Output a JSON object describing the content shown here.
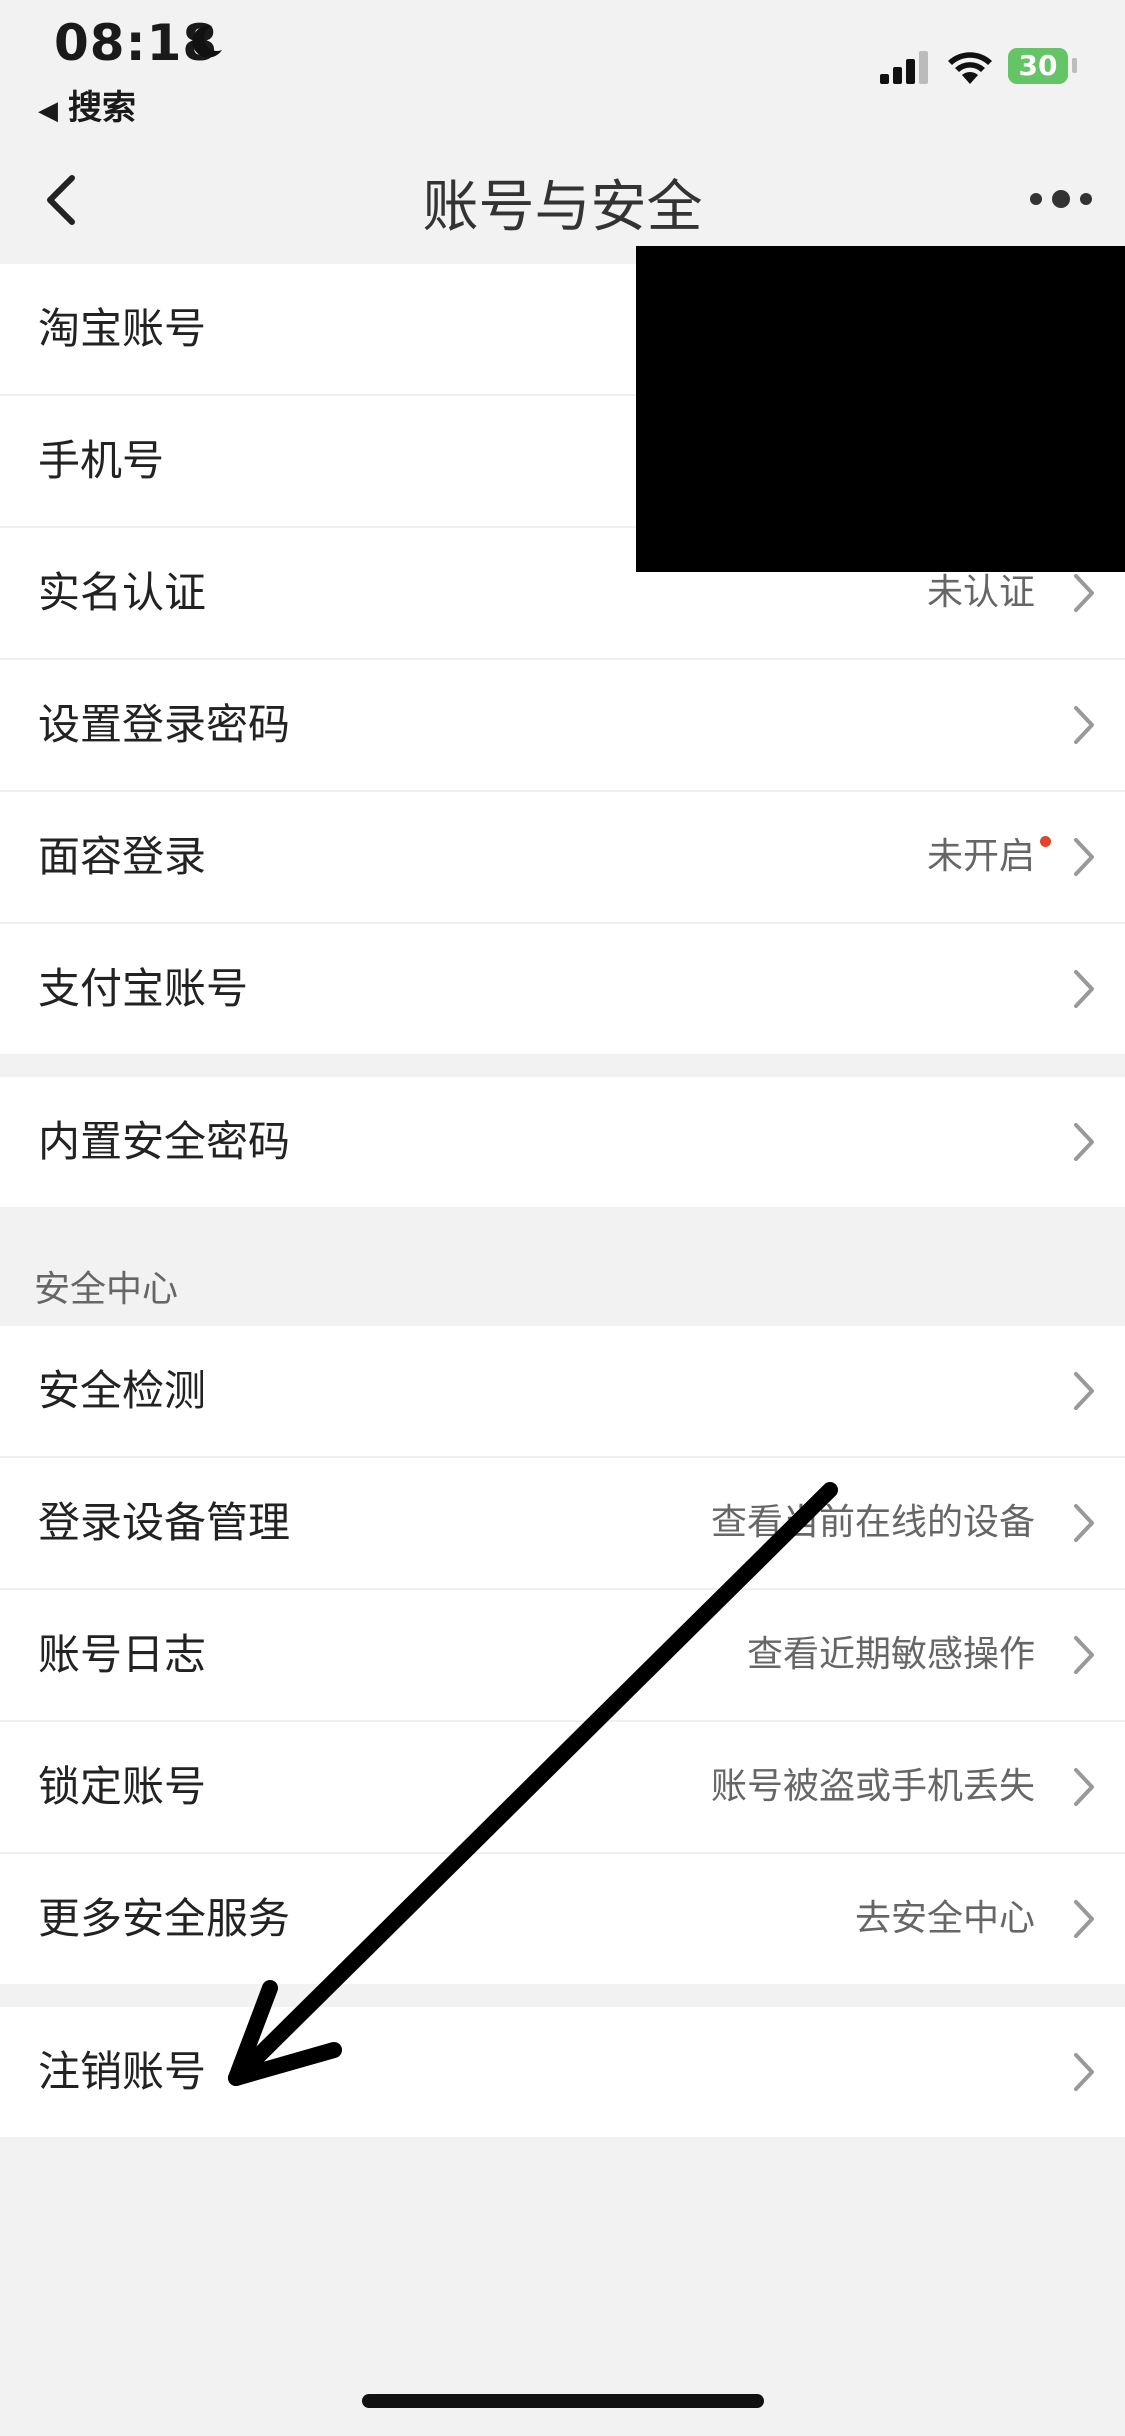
{
  "status_bar": {
    "time": "08:18",
    "back_app": "搜索",
    "battery": "30"
  },
  "nav": {
    "title": "账号与安全"
  },
  "group1": [
    {
      "label": "淘宝账号",
      "value": ""
    },
    {
      "label": "手机号",
      "value": ""
    },
    {
      "label": "实名认证",
      "value": "未认证"
    },
    {
      "label": "设置登录密码",
      "value": ""
    },
    {
      "label": "面容登录",
      "value": "未开启"
    },
    {
      "label": "支付宝账号",
      "value": ""
    }
  ],
  "group2": [
    {
      "label": "内置安全密码",
      "value": ""
    }
  ],
  "security_center": {
    "title": "安全中心",
    "items": [
      {
        "label": "安全检测",
        "value": ""
      },
      {
        "label": "登录设备管理",
        "value": "查看当前在线的设备"
      },
      {
        "label": "账号日志",
        "value": "查看近期敏感操作"
      },
      {
        "label": "锁定账号",
        "value": "账号被盗或手机丢失"
      },
      {
        "label": "更多安全服务",
        "value": "去安全中心"
      }
    ]
  },
  "group4": [
    {
      "label": "注销账号",
      "value": ""
    }
  ],
  "colors": {
    "background": "#f2f2f2",
    "dot": "#e0452c",
    "battery": "#64c466"
  }
}
